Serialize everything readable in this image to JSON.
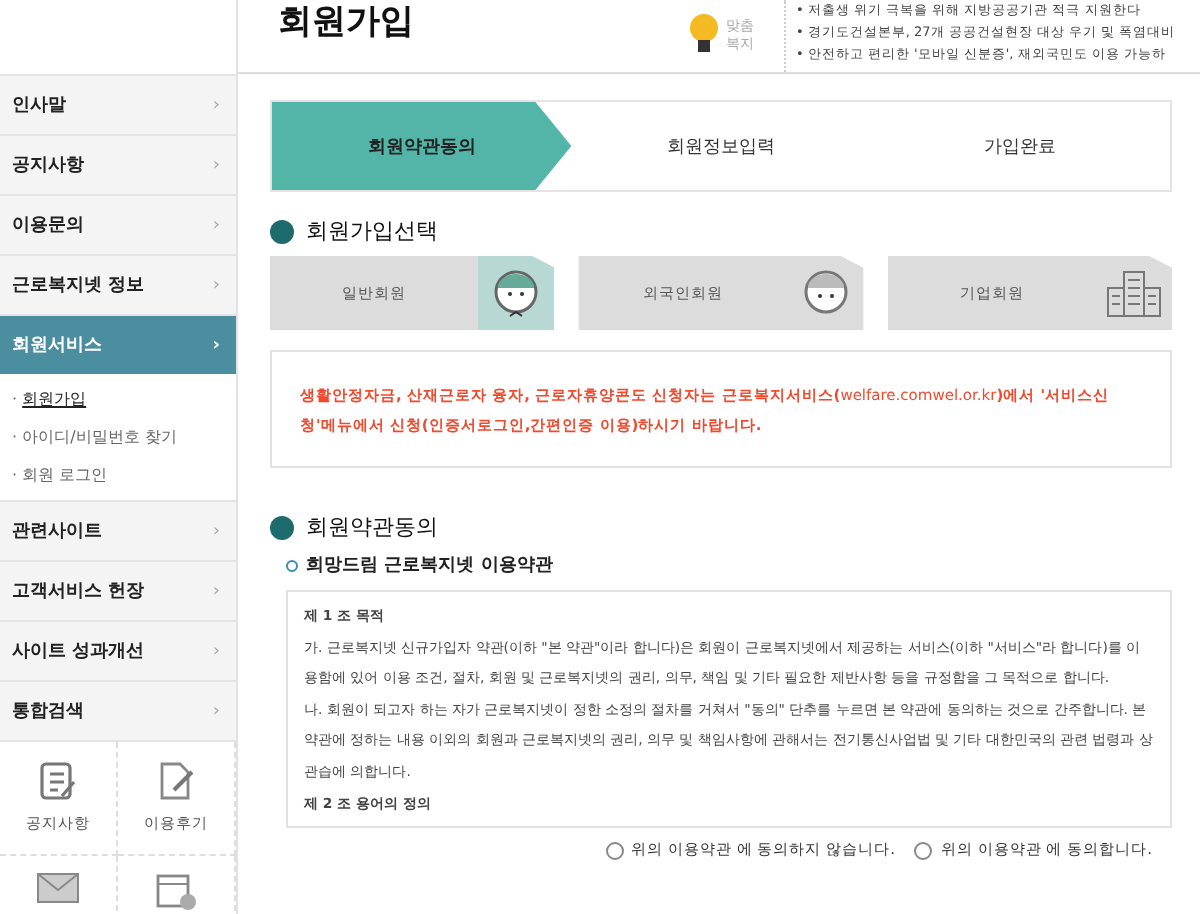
{
  "header": {
    "title": "회원가입",
    "badge": "맞춤\n복지",
    "news": [
      "• 저출생 위기 극복을 위해 지방공공기관 적극 지원한다",
      "• 경기도건설본부, 27개 공공건설현장 대상 우기 및 폭염대비",
      "• 안전하고 편리한 '모바일 신분증', 재외국민도 이용 가능하"
    ]
  },
  "sidebar": {
    "items": [
      {
        "label": "인사말",
        "arrow": "›",
        "selected": false
      },
      {
        "label": "공지사항",
        "arrow": "›",
        "selected": false
      },
      {
        "label": "이용문의",
        "arrow": "›",
        "selected": false
      },
      {
        "label": "근로복지넷 정보",
        "arrow": "›",
        "selected": false
      },
      {
        "label": "회원서비스",
        "arrow": "›",
        "selected": true,
        "children": [
          {
            "marker": "·",
            "label": "회원가입",
            "selected": true
          },
          {
            "marker": "·",
            "label": "아이디/비밀번호 찾기",
            "selected": false
          },
          {
            "marker": "·",
            "label": "회원 로그인",
            "selected": false
          }
        ]
      },
      {
        "label": "관련사이트",
        "arrow": "›",
        "selected": false
      },
      {
        "label": "고객서비스 헌장",
        "arrow": "›",
        "selected": false
      },
      {
        "label": "사이트 성과개선",
        "arrow": "›",
        "selected": false
      },
      {
        "label": "통합검색",
        "arrow": "›",
        "selected": false
      }
    ],
    "shortcuts": [
      {
        "kind": "notice",
        "label": "공지사항"
      },
      {
        "kind": "review",
        "label": "이용후기"
      },
      {
        "kind": "mail"
      },
      {
        "kind": "calendar"
      }
    ]
  },
  "steps": [
    {
      "label": "회원약관동의",
      "selected": true
    },
    {
      "label": "회원정보입력",
      "selected": false
    },
    {
      "label": "가입완료",
      "selected": false
    }
  ],
  "member_select": {
    "title": "회원가입선택",
    "types": [
      {
        "kind": "person",
        "label": "일반회원",
        "selected": true
      },
      {
        "kind": "foreigner",
        "label": "외국인회원",
        "selected": false
      },
      {
        "kind": "company",
        "label": "기업회원",
        "selected": false
      }
    ],
    "notice": "생활안정자금, 산재근로자 융자, 근로자휴양콘도 신청자는 근로복지서비스(**welfare.comwel.or.kr**)에서 '서비스신청'메뉴에서 신청(인증서로그인,간편인증 이용)하시기 바랍니다."
  },
  "terms": {
    "title": "회원약관동의",
    "subtitle": "희망드림 근로복지넷 이용약관",
    "paragraphs": [
      {
        "kind": "heading",
        "text": "제 1 조 목적"
      },
      {
        "kind": "body",
        "text": "가. 근로복지넷 신규가입자 약관(이하 \"본 약관\"이라 합니다)은 회원이 근로복지넷에서 제공하는 서비스(이하 \"서비스\"라 합니다)를 이용함에 있어 이용 조건, 절차, 회원 및 근로복지넷의 권리, 의무, 책임 및 기타 필요한 제반사항 등을 규정함을 그 목적으로 합니다."
      },
      {
        "kind": "body",
        "text": "나. 회원이 되고자 하는 자가 근로복지넷이 정한 소정의 절차를 거쳐서 \"동의\" 단추를 누르면 본 약관에 동의하는 것으로 간주합니다. 본 약관에 정하는 내용 이외의 회원과 근로복지넷의 권리, 의무 및 책임사항에 관해서는 전기통신사업법 및 기타 대한민국의 관련 법령과 상관습에 의합니다."
      },
      {
        "kind": "heading",
        "text": "제 2 조 용어의 정의"
      }
    ],
    "options": [
      {
        "label": "위의 이용약관 에 동의하지 않습니다.",
        "selected": false
      },
      {
        "label": "위의 이용약관 에 동의합니다.",
        "selected": false
      }
    ]
  }
}
